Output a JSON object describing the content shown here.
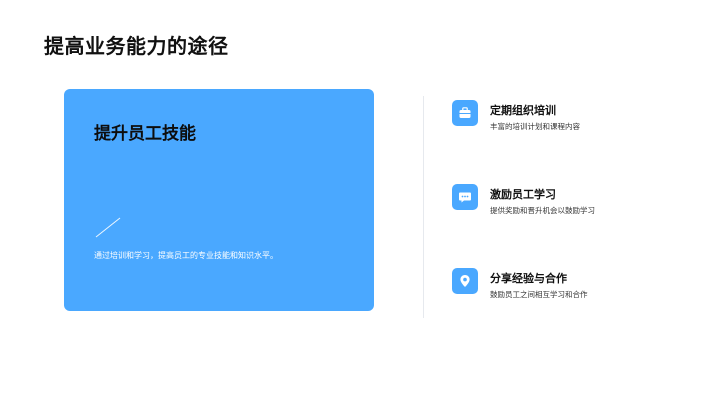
{
  "slide": {
    "title": "提高业务能力的途径"
  },
  "card": {
    "title": "提升员工技能",
    "description": "通过培训和学习，提高员工的专业技能和知识水平。",
    "background_color": "#4aa8ff"
  },
  "items": [
    {
      "icon": "briefcase-icon",
      "title": "定期组织培训",
      "description": "丰富的培训计划和课程内容"
    },
    {
      "icon": "chat-bubble-icon",
      "title": "激励员工学习",
      "description": "提供奖励和晋升机会以鼓励学习"
    },
    {
      "icon": "location-pin-icon",
      "title": "分享经验与合作",
      "description": "鼓励员工之间相互学习和合作"
    }
  ],
  "colors": {
    "accent": "#4aa8ff",
    "divider": "#e6e9ee"
  }
}
